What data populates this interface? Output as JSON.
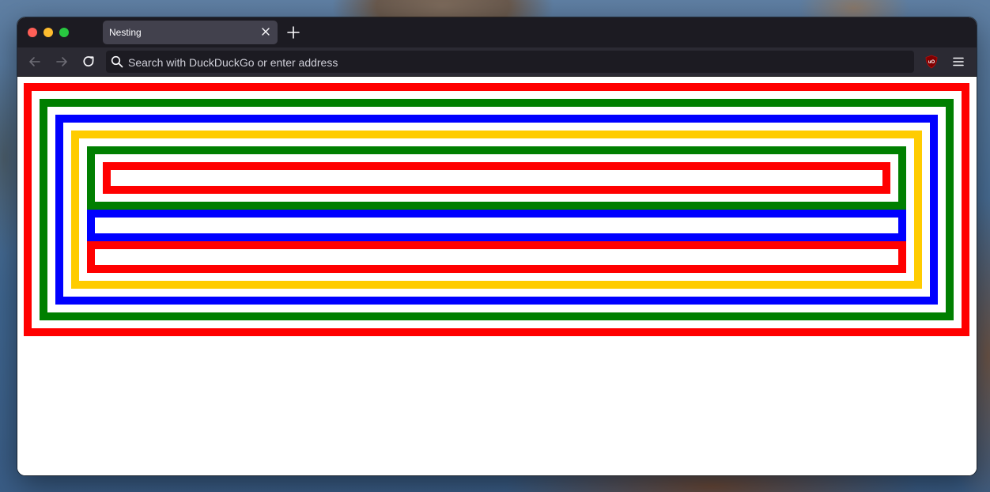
{
  "browser": {
    "tab": {
      "title": "Nesting",
      "close_icon": "close-icon"
    },
    "new_tab_icon": "plus-icon",
    "nav": {
      "back_icon": "arrow-left-icon",
      "forward_icon": "arrow-right-icon",
      "reload_icon": "reload-icon"
    },
    "urlbar": {
      "placeholder": "Search with DuckDuckGo or enter address",
      "search_icon": "search-icon"
    },
    "extension_icon": "ublock-origin-icon",
    "menu_icon": "hamburger-menu-icon"
  },
  "page": {
    "colors": {
      "red": "#ff0000",
      "green": "#007f00",
      "blue": "#0000ff",
      "yellow": "#ffcc00"
    }
  }
}
